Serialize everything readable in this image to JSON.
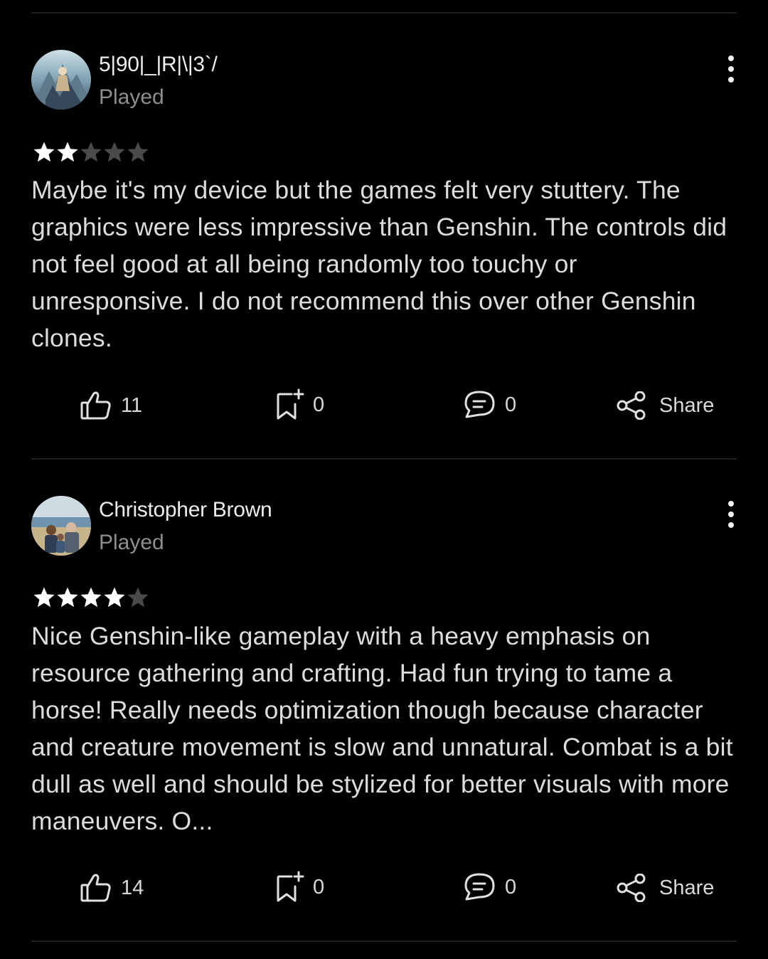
{
  "reviews": [
    {
      "username": "5|90|_|R|\\|3`/",
      "status": "Played",
      "rating": 2,
      "max_rating": 5,
      "text": "Maybe it's my device but the games felt very stuttery. The graphics were less impressive than Genshin. The controls did not feel good at all being randomly too touchy or unresponsive. I do not recommend this over other Genshin clones.",
      "likes": "11",
      "saves": "0",
      "comments": "0",
      "share_label": "Share"
    },
    {
      "username": "Christopher Brown",
      "status": "Played",
      "rating": 4,
      "max_rating": 5,
      "text": "Nice Genshin-like gameplay with a heavy emphasis on resource gathering and crafting. Had fun trying to tame a horse! Really needs optimization though because character and creature movement is slow and unnatural. Combat is a bit dull as well and should be stylized for better visuals with more maneuvers. O...",
      "likes": "14",
      "saves": "0",
      "comments": "0",
      "share_label": "Share"
    }
  ],
  "colors": {
    "background": "#000000",
    "star_filled": "#ffffff",
    "star_empty": "#4a4a4a",
    "secondary_text": "#8e8e8e"
  },
  "icons": {
    "like": "thumbs-up-icon",
    "save": "bookmark-plus-icon",
    "comment": "comment-bubble-icon",
    "share": "share-icon",
    "more": "vertical-ellipsis-icon"
  }
}
